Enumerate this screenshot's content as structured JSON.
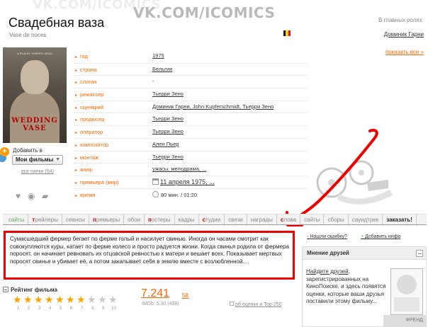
{
  "watermark": {
    "main": "VK.COM/ICOMICS",
    "ghost": "VK.COM/ICOMICS"
  },
  "film": {
    "title": "Свадебная ваза",
    "original_title": "Vase de noces",
    "flag_colors": [
      "#111111",
      "#f7d000",
      "#e8112d"
    ]
  },
  "roles": {
    "heading": "В главных ролях:",
    "actor": "Доминик Гарни",
    "show_all": "показать все »"
  },
  "poster": {
    "title": "WEDDING VASE",
    "tagline": "A FILM BY THIERRY ZENO"
  },
  "add_to": {
    "label": "Добавить в",
    "plus": "+",
    "selected": "Мои фильмы",
    "folders": "все папки (54)"
  },
  "poster_icons": {
    "heart": "heart-icon",
    "eye": "eye-icon",
    "comment": "comment-icon"
  },
  "info": [
    {
      "key": "год",
      "value": "1975",
      "link": true
    },
    {
      "key": "страна",
      "value": "Бельгия",
      "link": true
    },
    {
      "key": "слоган",
      "value": "-",
      "link": false
    },
    {
      "key": "режиссер",
      "value": "Тьерри Зено",
      "link": true
    },
    {
      "key": "сценарий",
      "value": "Доминик Гарни, John Kupferschmidt, Тьерри Зено",
      "link": true
    },
    {
      "key": "продюсер",
      "value": "Тьерри Зено",
      "link": true
    },
    {
      "key": "оператор",
      "value": "Тьерри Зено",
      "link": true
    },
    {
      "key": "композитор",
      "value": "Ален Пьер",
      "link": true
    },
    {
      "key": "монтаж",
      "value": "Тьерри Зено",
      "link": true
    },
    {
      "key": "жанр",
      "value": "ужасы, мелодрама, ...",
      "link": true
    },
    {
      "key": "премьера (мир)",
      "value": "11 апреля 1975, ...",
      "link": true
    },
    {
      "key": "время",
      "value": "80 мин. / 01:20",
      "link": false
    }
  ],
  "tabs": [
    {
      "label": "сайты",
      "style": "green"
    },
    {
      "label_bold": "т",
      "label": "рейлеры",
      "style": ""
    },
    {
      "label": "сеансы",
      "style": ""
    },
    {
      "label_bold": "п",
      "label": "ремьеры",
      "style": ""
    },
    {
      "label": "обои",
      "style": ""
    },
    {
      "label_bold": "п",
      "label": "остеры",
      "style": ""
    },
    {
      "label": "кадры",
      "style": ""
    },
    {
      "label_bold": "с",
      "label": "тудии",
      "style": ""
    },
    {
      "label": "связи",
      "style": ""
    },
    {
      "label": "награды",
      "style": ""
    },
    {
      "label_bold": "с",
      "label": "лова",
      "style": ""
    },
    {
      "label": "сайты",
      "style": ""
    },
    {
      "label": "сборы",
      "style": ""
    },
    {
      "label": "саундтрек",
      "style": ""
    },
    {
      "label": "заказать!",
      "style": "bold"
    }
  ],
  "description": "Сумасшедший фермер бегает по ферме голый и насилует свинью. Иногда он часами смотрит как совокупляются куры, катает по ферме колесо и просто радуется жизни. Когда свинья родила от фермера поросят, он начинает ревновать их отцовской ревностью к матери и вешает всех. Показывает мертвых поросят свинье и убивает её, а потом закапывает себя в землю вместе с возлюбленной....",
  "rating": {
    "heading": "Рейтинг фильма",
    "value": "7.241",
    "votes": "58",
    "imdb": "IMDb: 5.30 (439)",
    "top_link": "рб оценки и Top-250",
    "stars_filled": 7,
    "stars_total": 10,
    "star_numbers": [
      "1",
      "2",
      "3",
      "4",
      "5",
      "6",
      "7",
      "8",
      "9",
      "10"
    ]
  },
  "side": {
    "error_link": "Нашли ошибку?",
    "add_info": "Добавить инфо"
  },
  "friends": {
    "heading": "Мнение друзей",
    "text_link": "Найдите друзей",
    "text_rest": ", зарегистрированных на КиноПоиске, и здесь появятся оценки, которые ваши друзья поставили этому фильму...",
    "corner": "ФРЕНД"
  },
  "colors": {
    "accent": "#ff6600",
    "highlight_box": "#ee0000",
    "star": "#f7a600"
  }
}
